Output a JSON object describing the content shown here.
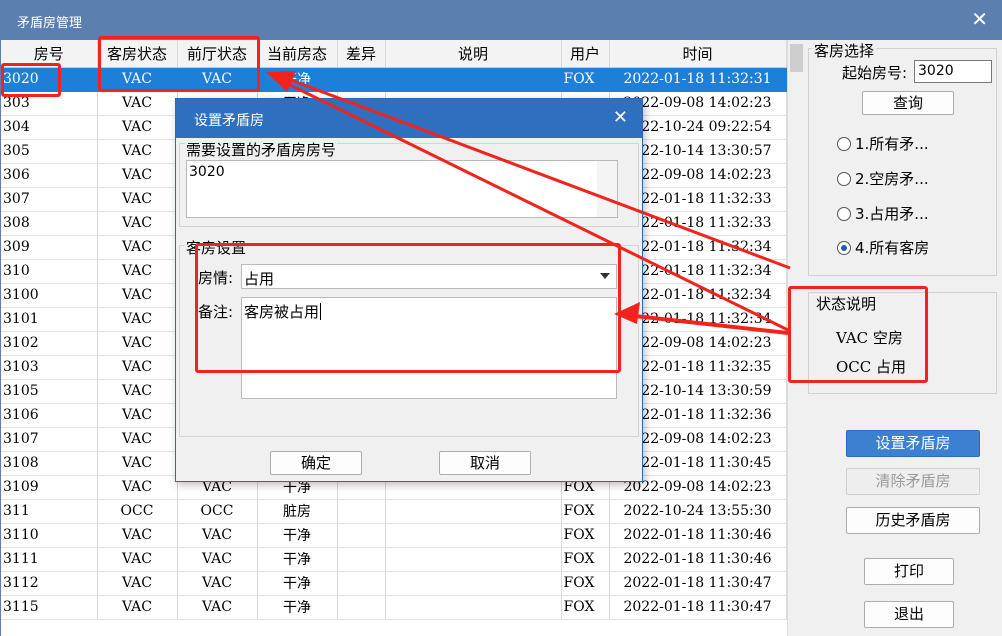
{
  "window": {
    "title": "矛盾房管理"
  },
  "grid": {
    "columns": [
      "房号",
      "客房状态",
      "前厅状态",
      "当前房态",
      "差异",
      "说明",
      "用户",
      "时间"
    ],
    "rows": [
      [
        "3020",
        "VAC",
        "VAC",
        "干净",
        "",
        "",
        "FOX",
        "2022-01-18  11:32:31"
      ],
      [
        "303",
        "VAC",
        "",
        "干净",
        "",
        "",
        "",
        "2022-09-08  14:02:23"
      ],
      [
        "304",
        "VAC",
        "",
        "",
        "",
        "",
        "",
        "2022-10-24  09:22:54"
      ],
      [
        "305",
        "VAC",
        "",
        "",
        "",
        "",
        "",
        "2022-10-14  13:30:57"
      ],
      [
        "306",
        "VAC",
        "",
        "",
        "",
        "",
        "",
        "2022-09-08  14:02:23"
      ],
      [
        "307",
        "VAC",
        "",
        "",
        "",
        "",
        "",
        "2022-01-18  11:32:33"
      ],
      [
        "308",
        "VAC",
        "",
        "",
        "",
        "",
        "",
        "2022-01-18  11:32:33"
      ],
      [
        "309",
        "VAC",
        "",
        "",
        "",
        "",
        "",
        "2022-01-18  11:32:34"
      ],
      [
        "310",
        "VAC",
        "",
        "",
        "",
        "",
        "",
        "2022-01-18  11:32:34"
      ],
      [
        "3100",
        "VAC",
        "",
        "",
        "",
        "",
        "",
        "2022-01-18  11:32:34"
      ],
      [
        "3101",
        "VAC",
        "",
        "",
        "",
        "",
        "",
        "2022-01-18  11:32:34"
      ],
      [
        "3102",
        "VAC",
        "",
        "",
        "",
        "",
        "",
        "2022-09-08  14:02:23"
      ],
      [
        "3103",
        "VAC",
        "",
        "",
        "",
        "",
        "",
        "2022-01-18  11:32:35"
      ],
      [
        "3105",
        "VAC",
        "",
        "",
        "",
        "",
        "",
        "2022-10-14  13:30:59"
      ],
      [
        "3106",
        "VAC",
        "",
        "",
        "",
        "",
        "",
        "2022-01-18  11:32:36"
      ],
      [
        "3107",
        "VAC",
        "",
        "",
        "",
        "",
        "",
        "2022-09-08  14:02:23"
      ],
      [
        "3108",
        "VAC",
        "",
        "",
        "",
        "",
        "",
        "2022-01-18  11:30:45"
      ],
      [
        "3109",
        "VAC",
        "VAC",
        "干净",
        "",
        "",
        "FOX",
        "2022-09-08  14:02:23"
      ],
      [
        "311",
        "OCC",
        "OCC",
        "脏房",
        "",
        "",
        "FOX",
        "2022-10-24  13:55:30"
      ],
      [
        "3110",
        "VAC",
        "VAC",
        "干净",
        "",
        "",
        "FOX",
        "2022-01-18  11:30:46"
      ],
      [
        "3111",
        "VAC",
        "VAC",
        "干净",
        "",
        "",
        "FOX",
        "2022-01-18  11:30:46"
      ],
      [
        "3112",
        "VAC",
        "VAC",
        "干净",
        "",
        "",
        "FOX",
        "2022-01-18  11:30:47"
      ],
      [
        "3115",
        "VAC",
        "VAC",
        "干净",
        "",
        "",
        "FOX",
        "2022-01-18  11:30:47"
      ]
    ]
  },
  "panel": {
    "room_select_label": "客房选择",
    "start_room_label": "起始房号:",
    "start_room_value": "3020",
    "query_button": "查询",
    "radios": [
      {
        "label": "1.所有矛...",
        "checked": false
      },
      {
        "label": "2.空房矛...",
        "checked": false
      },
      {
        "label": "3.占用矛...",
        "checked": false
      },
      {
        "label": "4.所有客房",
        "checked": true
      }
    ],
    "status_legend_label": "状态说明",
    "legend": [
      {
        "code": "VAC",
        "text": "空房"
      },
      {
        "code": "OCC",
        "text": "占用"
      }
    ],
    "buttons": {
      "set": "设置矛盾房",
      "clear": "清除矛盾房",
      "history": "历史矛盾房",
      "print": "打印",
      "exit": "退出"
    }
  },
  "dialog": {
    "title": "设置矛盾房",
    "room_section_label": "需要设置的矛盾房房号",
    "room_value": "3020",
    "room_settings_label": "客房设置",
    "condition_label": "房情:",
    "condition_value": "占用",
    "remark_label": "备注:",
    "remark_value": "客房被占用",
    "ok_button": "确定",
    "cancel_button": "取消"
  },
  "colors": {
    "titlebar": "#5b7fae",
    "dialog_titlebar": "#2f6fbf",
    "selection": "#1e7fd9",
    "primary_button": "#3c80d1",
    "annotation_red": "#f2231c"
  }
}
